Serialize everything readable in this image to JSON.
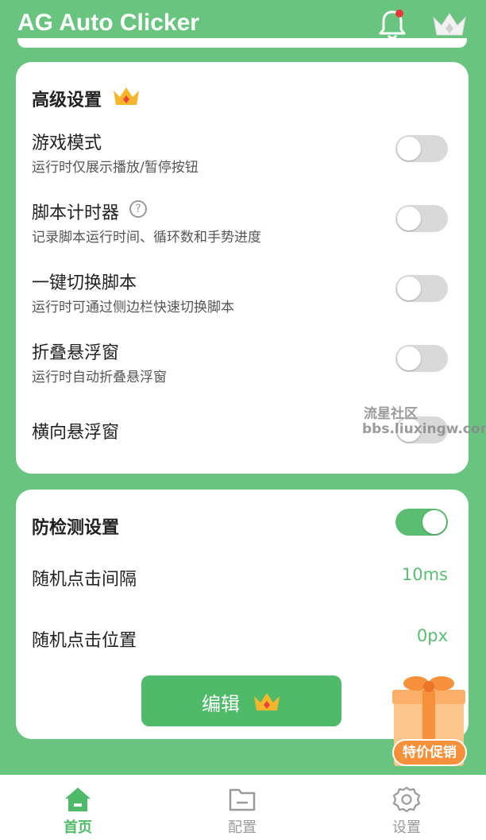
{
  "app": {
    "title": "AG Auto Clicker"
  },
  "header": {
    "notification_icon": "bell-icon",
    "vip_icon": "crown-icon",
    "accent_color": "#68c47f"
  },
  "advanced": {
    "title": "高级设置",
    "items": [
      {
        "title": "游戏模式",
        "subtitle": "运行时仅展示播放/暂停按钮",
        "enabled": false
      },
      {
        "title": "脚本计时器",
        "subtitle": "记录脚本运行时间、循环数和手势进度",
        "enabled": false,
        "help": "?"
      },
      {
        "title": "一键切换脚本",
        "subtitle": "运行时可通过侧边栏快速切换脚本",
        "enabled": false
      },
      {
        "title": "折叠悬浮窗",
        "subtitle": "运行时自动折叠悬浮窗",
        "enabled": false
      },
      {
        "title": "横向悬浮窗",
        "subtitle": "",
        "enabled": false
      }
    ]
  },
  "anti_detect": {
    "title": "防检测设置",
    "enabled": true,
    "interval_label": "随机点击间隔",
    "interval_value": "10ms",
    "position_label": "随机点击位置",
    "position_value": "0px",
    "edit_label": "编辑"
  },
  "watermark": {
    "line1": "流星社区",
    "line2": "bbs.liuxingw.com"
  },
  "promo": {
    "label": "特价促销"
  },
  "nav": {
    "home": "首页",
    "config": "配置",
    "settings": "设置",
    "active": "home"
  }
}
